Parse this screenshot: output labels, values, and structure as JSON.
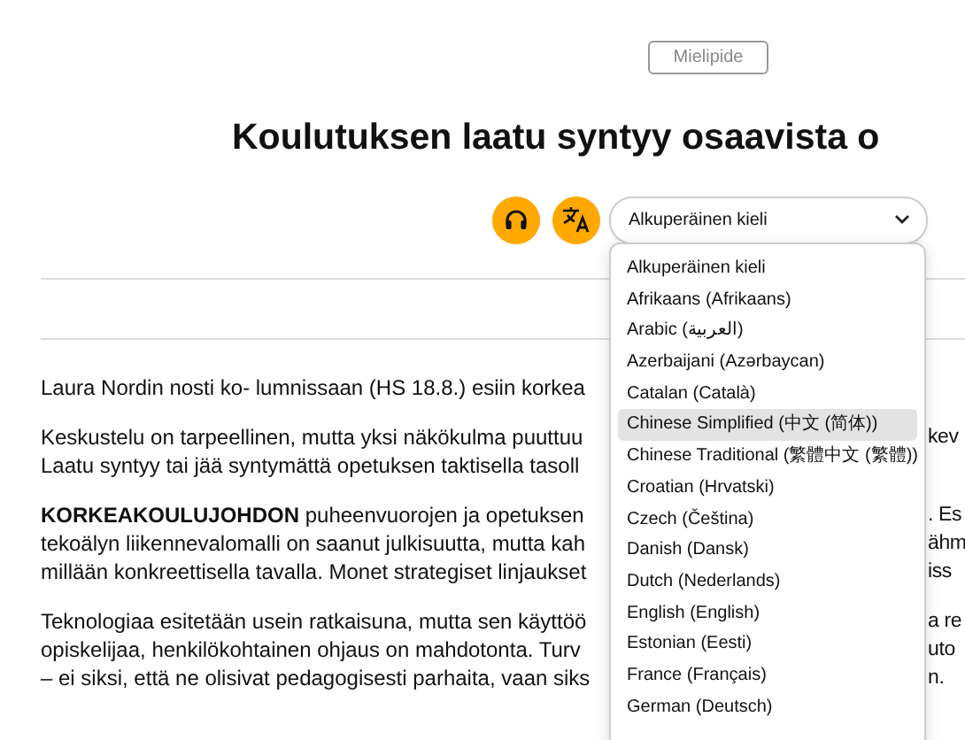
{
  "tag": {
    "label": "Mielipide"
  },
  "title": "Koulutuksen laatu syntyy osaavista o",
  "controls": {
    "listen_button": {
      "kind": "listen"
    },
    "translate_button": {
      "kind": "translate"
    },
    "language_select": {
      "value": "Alkuperäinen kieli",
      "expanded": true
    }
  },
  "language_options": [
    {
      "label": "Alkuperäinen kieli",
      "selected": false
    },
    {
      "label": "Afrikaans (Afrikaans)",
      "selected": false
    },
    {
      "label": "Arabic (العربية)",
      "selected": false
    },
    {
      "label": "Azerbaijani (Azərbaycan)",
      "selected": false
    },
    {
      "label": "Catalan (Català)",
      "selected": false
    },
    {
      "label": "Chinese Simplified (中文 (简体))",
      "selected": true
    },
    {
      "label": "Chinese Traditional (繁體中文 (繁體))",
      "selected": false
    },
    {
      "label": "Croatian (Hrvatski)",
      "selected": false
    },
    {
      "label": "Czech (Čeština)",
      "selected": false
    },
    {
      "label": "Danish (Dansk)",
      "selected": false
    },
    {
      "label": "Dutch (Nederlands)",
      "selected": false
    },
    {
      "label": "English (English)",
      "selected": false
    },
    {
      "label": "Estonian (Eesti)",
      "selected": false
    },
    {
      "label": "France (Français)",
      "selected": false
    },
    {
      "label": "German (Deutsch)",
      "selected": false
    }
  ],
  "article": [
    {
      "lines": [
        {
          "left": "Laura Nordin nosti ko- lumnissaan (HS 18.8.) esiin korkea"
        }
      ]
    },
    {
      "lines": [
        {
          "left": "Keskustelu on tarpeellinen, mutta yksi näkökulma puuttuu",
          "right": "kev"
        },
        {
          "left": "Laatu syntyy tai jää syntymättä opetuksen taktisella tasoll"
        }
      ]
    },
    {
      "lines": [
        {
          "left": "**KORKEAKOULUJOHDON** puheenvuorojen ja opetuksen",
          "right": ". Es"
        },
        {
          "left": "tekoälyn liikennevalomalli on saanut julkisuutta, mutta kah",
          "right": "ähm"
        },
        {
          "left": "millään konkreettisella tavalla. Monet strategiset linjaukset",
          "right": "iss"
        }
      ]
    },
    {
      "lines": [
        {
          "left": "Teknologiaa esitetään usein ratkaisuna, mutta sen käyttöö",
          "right": "a re"
        },
        {
          "left": "opiskelijaa, henkilökohtainen ohjaus on mahdotonta. Turv",
          "right": "uto"
        },
        {
          "left": "– ei siksi, että ne olisivat pedagogisesti parhaita, vaan siks",
          "right": "n."
        }
      ]
    }
  ]
}
